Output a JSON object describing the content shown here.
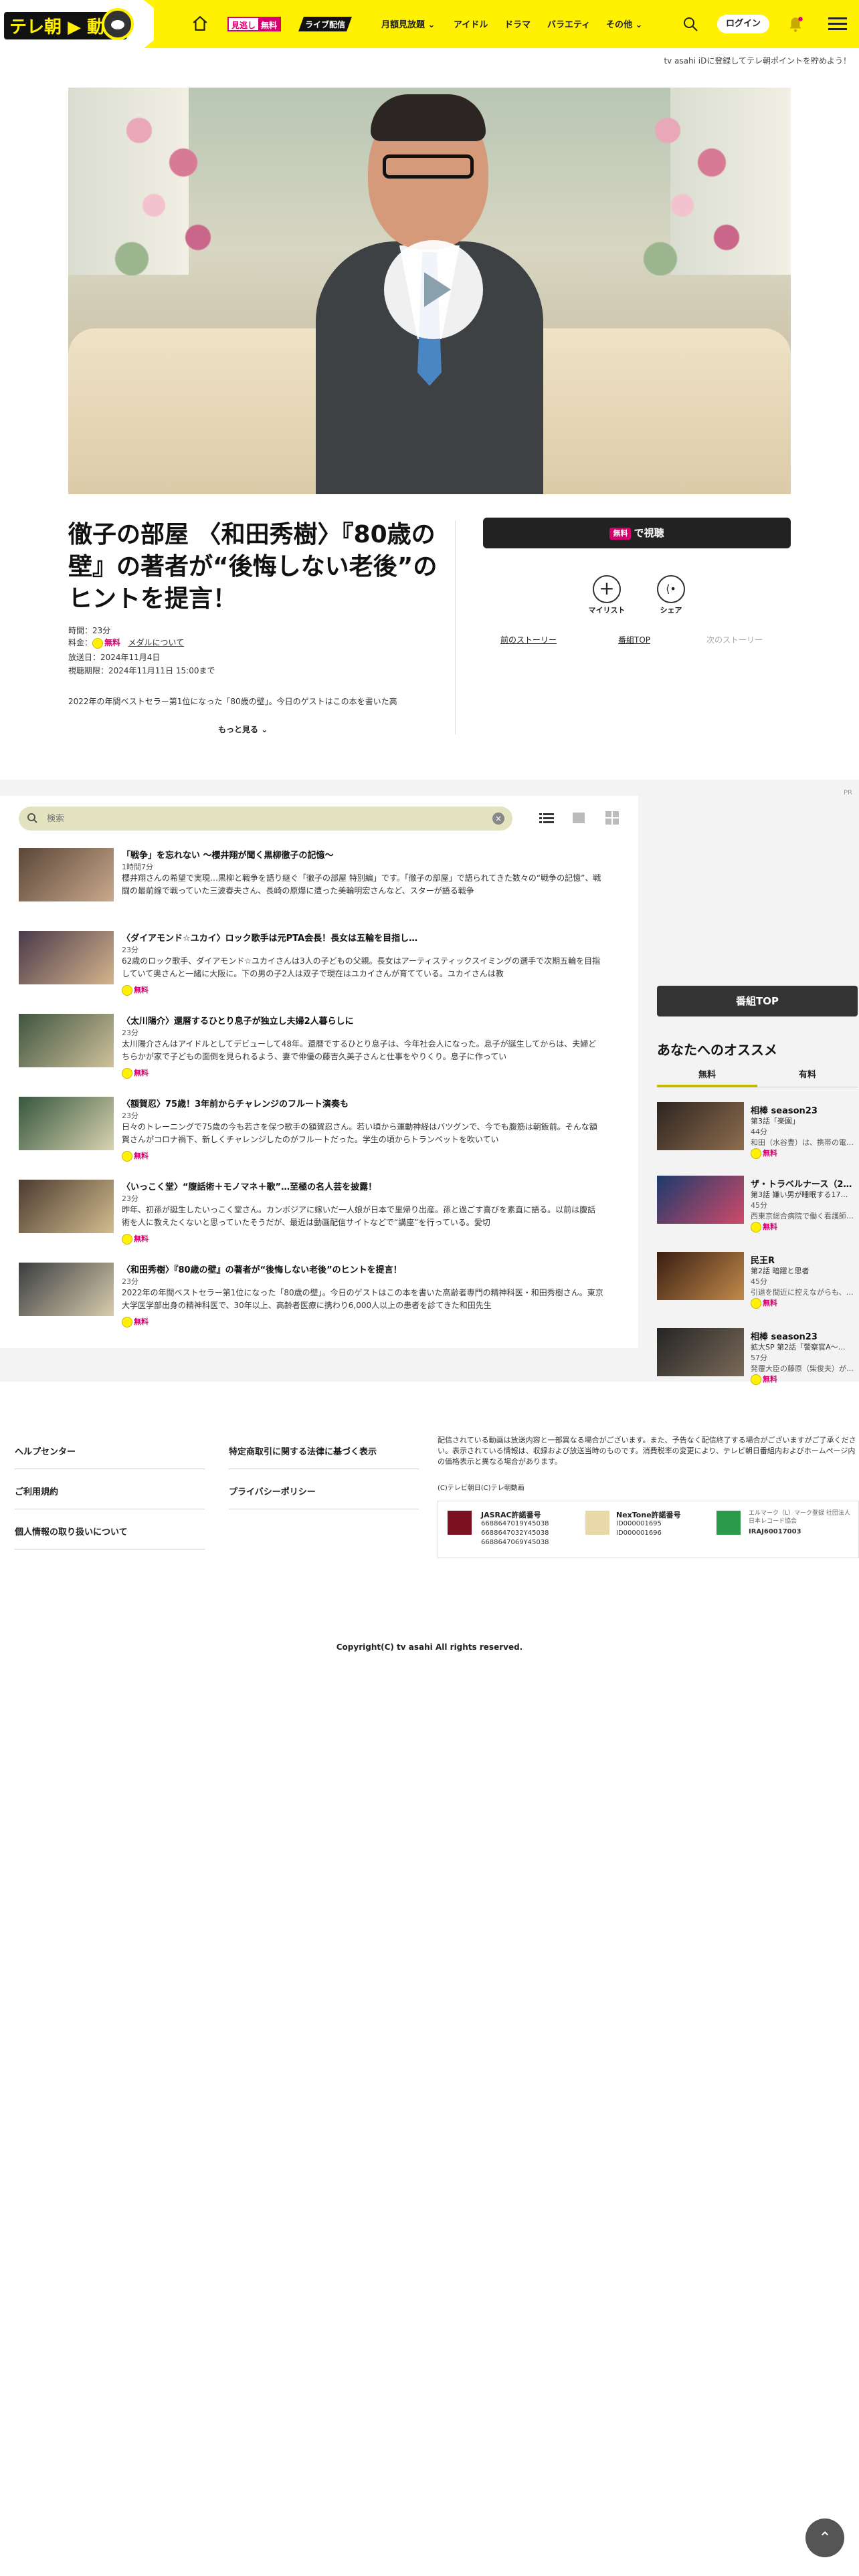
{
  "header": {
    "logo_text": "テレ朝",
    "logo_text2": "動画",
    "mitai_label": "見逃し",
    "mitai_free": "無料",
    "live_label": "ライブ配信",
    "nav": [
      "月額見放題",
      "アイドル",
      "ドラマ",
      "バラエティ",
      "その他"
    ],
    "login_label": "ログイン",
    "promo": "tv asahi iDに登録してテレ朝ポイントを貯めよう！"
  },
  "episode": {
    "title": "徹子の部屋 〈和田秀樹〉『80歳の壁』の著者が“後悔しない老後”のヒントを提言！",
    "duration": "時間：23分",
    "price_label": "料金：",
    "price": "無料",
    "media_link": "メダルについて",
    "air_date": "放送日：2024年11月4日",
    "deadline": "視聴期限：2024年11月11日 15:00まで",
    "description": "2022年の年間ベストセラー第1位になった「80歳の壁」。今日のゲストはこの本を書いた高",
    "more_label": "もっと見る",
    "watch_badge": "無料",
    "watch_label": "で視聴",
    "mylist_label": "マイリスト",
    "share_label": "シェア",
    "prev_story": "前のストーリー",
    "program_top": "番組TOP",
    "next_story": "次のストーリー"
  },
  "search": {
    "placeholder": "検索"
  },
  "ad_label": "PR",
  "episodes": [
    {
      "title": "「戦争」を忘れない ～櫻井翔が聞く黒柳徹子の記憶～",
      "duration": "1時間7分",
      "description": "櫻井翔さんの希望で実現…黒柳と戦争を語り継ぐ「徹子の部屋 特別編」です。「徹子の部屋」で語られてきた数々の“戦争の記憶”、戦闘の最前線で戦っていた三波春夫さん、長崎の原爆に遭った美輪明宏さんなど、スターが語る戦争",
      "free": ""
    },
    {
      "title": "〈ダイアモンド☆ユカイ〉ロック歌手は元PTA会長！長女は五輪を目指し…",
      "duration": "23分",
      "description": "62歳のロック歌手、ダイアモンド☆ユカイさんは3人の子どもの父親。長女はアーティスティックスイミングの選手で次期五輪を目指していて奥さんと一緒に大阪に。下の男の子2人は双子で現在はユカイさんが育てている。ユカイさんは教",
      "free": "無料"
    },
    {
      "title": "〈太川陽介〉還暦するひとり息子が独立し夫婦2人暮らしに",
      "duration": "23分",
      "description": "太川陽介さんはアイドルとしてデビューして48年。還暦でするひとり息子は、今年社会人になった。息子が誕生してからは、夫婦どちらかが家で子どもの面倒を見られるよう、妻で俳優の藤吉久美子さんと仕事をやりくり。息子に作ってい",
      "free": "無料"
    },
    {
      "title": "〈額賀忍〉75歳！3年前からチャレンジのフルート演奏も",
      "duration": "23分",
      "description": "日々のトレーニングで75歳の今も若さを保つ歌手の額賀忍さん。若い頃から運動神経はバツグンで、今でも腹筋は朝飯前。そんな額賀さんがコロナ禍下、新しくチャレンジしたのがフルートだった。学生の頃からトランペットを吹いてい",
      "free": "無料"
    },
    {
      "title": "〈いっこく堂〉“腹話術＋モノマネ＋歌”…至極の名人芸を披露！",
      "duration": "23分",
      "description": "昨年、初孫が誕生したいっこく堂さん。カンボジアに嫁いだ一人娘が日本で里帰り出産。孫と過ごす喜びを素直に語る。以前は腹話術を人に教えたくないと思っていたそうだが、最近は動画配信サイトなどで“講座”を行っている。愛切",
      "free": "無料"
    },
    {
      "title": "〈和田秀樹〉『80歳の壁』の著者が“後悔しない老後”のヒントを提言！",
      "duration": "23分",
      "description": "2022年の年間ベストセラー第1位になった「80歳の壁」。今日のゲストはこの本を書いた高齢者専門の精神科医・和田秀樹さん。東京大学医学部出身の精神科医で、30年以上、高齢者医療に携わり6,000人以上の患者を診てきた和田先生",
      "free": "無料"
    }
  ],
  "sidebar": {
    "program_top_button": "番組TOP",
    "recommend_title": "あなたへのオススメ",
    "tab_free": "無料",
    "tab_paid": "有料",
    "items": [
      {
        "title": "相棒 season23",
        "sub": "第3話「楽園」",
        "duration": "44分",
        "desc": "和田（水谷豊）は、携帯の電…",
        "free": "無料"
      },
      {
        "title": "ザ・トラベルナース（2…",
        "sub": "第3話 嫌い男が睡眠する17…",
        "duration": "45分",
        "desc": "西東京総合病院で働く看護師…",
        "free": "無料"
      },
      {
        "title": "民王R",
        "sub": "第2話 暗躍と思者",
        "duration": "45分",
        "desc": "引退を間近に控えながらも、…",
        "free": "無料"
      },
      {
        "title": "相棒 season23",
        "sub": "拡大SP 第2話「警察官A～…",
        "duration": "57分",
        "desc": "発覆大臣の藤原（柴俊夫）が…",
        "free": "無料"
      }
    ]
  },
  "footer": {
    "links_left": [
      "ヘルプセンター",
      "ご利用規約",
      "個人情報の取り扱いについて"
    ],
    "links_right": [
      "特定商取引に関する法律に基づく表示",
      "プライバシーポリシー"
    ],
    "notice": "配信されている動画は放送内容と一部異なる場合がございます。また、予告なく配信終了する場合がございますがご了承ください。表示されている情報は、収録および放送当時のものです。消費税率の変更により、テレビ朝日番組内およびホームページ内の価格表示と異なる場合があります。",
    "credit": "(C)テレビ朝日(C)テレ朝動画",
    "jasrac_name": "JASRAC許諾番号",
    "jasrac_nums": [
      "6688647019Y45038",
      "6688647032Y45038",
      "6688647069Y45038"
    ],
    "nextone_name": "NexTone許諾番号",
    "nextone_nums": [
      "ID000001695",
      "ID000001696"
    ],
    "riaj_text": "エルマーク（L）マーク登録 社団法人日本レコード協会",
    "riaj_num": "IRAJ60017003",
    "copyright": "Copyright(C) tv asahi All rights reserved."
  },
  "colors": {
    "brand_yellow": "#fff100",
    "accent_pink": "#d6006e",
    "dark": "#222222"
  }
}
